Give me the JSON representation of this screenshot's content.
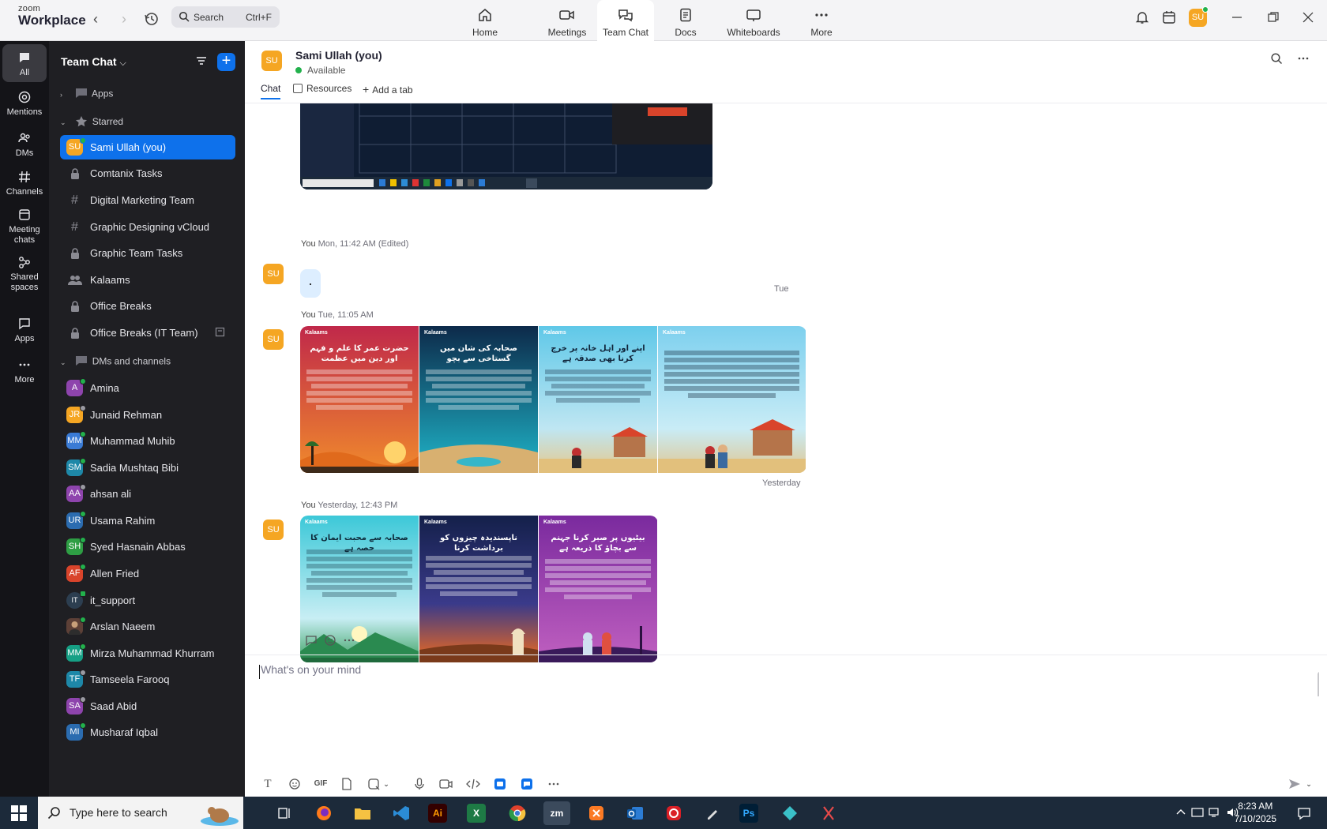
{
  "app": {
    "logo_line1": "zoom",
    "logo_line2": "Workplace"
  },
  "search": {
    "placeholder": "Search",
    "shortcut": "Ctrl+F"
  },
  "tabs": [
    {
      "label": "Home",
      "icon": "home-icon"
    },
    {
      "label": "Meetings",
      "icon": "video-icon"
    },
    {
      "label": "Team Chat",
      "icon": "chat-icon",
      "active": true
    },
    {
      "label": "Docs",
      "icon": "doc-icon"
    },
    {
      "label": "Whiteboards",
      "icon": "whiteboard-icon"
    },
    {
      "label": "More",
      "icon": "more-icon"
    }
  ],
  "user": {
    "initials": "SU",
    "status_color": "#22b14c"
  },
  "rail": [
    {
      "label": "All",
      "active": true
    },
    {
      "label": "Mentions"
    },
    {
      "label": "DMs"
    },
    {
      "label": "Channels"
    },
    {
      "label": "Meeting chats"
    },
    {
      "label": "Shared spaces"
    },
    {
      "label": "Apps"
    },
    {
      "label": "More"
    }
  ],
  "sidebar": {
    "title": "Team Chat",
    "sections": {
      "apps": "Apps",
      "starred": "Starred",
      "dms": "DMs and channels"
    },
    "starred": [
      {
        "label": "Sami Ullah (you)",
        "type": "avatar",
        "initials": "SU",
        "color": "#f5a623",
        "selected": true
      },
      {
        "label": "Comtanix Tasks",
        "type": "lock"
      },
      {
        "label": "Digital Marketing Team",
        "type": "hash"
      },
      {
        "label": "Graphic Designing vCloud",
        "type": "hash"
      },
      {
        "label": "Graphic Team Tasks",
        "type": "lock"
      },
      {
        "label": "Kalaams",
        "type": "group"
      },
      {
        "label": "Office Breaks",
        "type": "lock"
      },
      {
        "label": "Office Breaks (IT Team)",
        "type": "lock"
      }
    ],
    "dms": [
      {
        "label": "Amina",
        "initials": "A",
        "color": "#8e44ad",
        "status": "#22b14c"
      },
      {
        "label": "Junaid Rehman",
        "initials": "JR",
        "color": "#f5a623",
        "status": "#9a9aa2"
      },
      {
        "label": "Muhammad Muhib",
        "initials": "MM",
        "color": "#3a7bd5",
        "status": "#22b14c"
      },
      {
        "label": "Sadia Mushtaq Bibi",
        "initials": "SM",
        "color": "#1e88a8",
        "status": "#22b14c"
      },
      {
        "label": "ahsan ali",
        "initials": "AA",
        "color": "#8e44ad",
        "status": "#9a9aa2"
      },
      {
        "label": "Usama Rahim",
        "initials": "UR",
        "color": "#2b6cb0",
        "status": "#22b14c"
      },
      {
        "label": "Syed Hasnain Abbas",
        "initials": "SH",
        "color": "#2e9e44",
        "status": "#22b14c"
      },
      {
        "label": "Allen Fried",
        "initials": "AF",
        "color": "#d9442b",
        "status": "#22b14c"
      },
      {
        "label": "it_support",
        "initials": "IT",
        "color": "#2c3e50",
        "status": "#22b14c"
      },
      {
        "label": "Arslan Naeem",
        "initials": "",
        "color": "#5d4037",
        "status": "#22b14c"
      },
      {
        "label": "Mirza Muhammad Khurram",
        "initials": "MM",
        "color": "#16a085",
        "status": "#22b14c"
      },
      {
        "label": "Tamseela Farooq",
        "initials": "TF",
        "color": "#1e88a8",
        "status": "#9a9aa2"
      },
      {
        "label": "Saad Abid",
        "initials": "SA",
        "color": "#8e44ad",
        "status": "#9a9aa2"
      },
      {
        "label": "Musharaf Iqbal",
        "initials": "MI",
        "color": "#2b6cb0",
        "status": "#22b14c"
      }
    ]
  },
  "chat": {
    "name": "Sami Ullah (you)",
    "status": "Available",
    "tabs": {
      "chat": "Chat",
      "resources": "Resources",
      "add": "Add a tab"
    },
    "messages": [
      {
        "sender": "You",
        "time": "Mon, 11:42 AM (Edited)",
        "text": "."
      },
      {
        "sender": "You",
        "time": "Tue, 11:05 AM"
      },
      {
        "sender": "You",
        "time": "Yesterday, 12:43 PM"
      }
    ],
    "days": {
      "tue": "Tue",
      "yesterday": "Yesterday"
    },
    "cards_row1": [
      {
        "title": "حضرت عمر کا علم و فہم اور دین میں عظمت",
        "top": "#c0284a",
        "bottom": "#f08a2c"
      },
      {
        "title": "صحابہ کی شان میں گستاخی سے بچو",
        "top": "#0d2a4a",
        "bottom": "#1fb5c9"
      },
      {
        "title": "اپنے اور اہل خانہ پر خرچ کرنا بھی صدقہ ہے",
        "top": "#5fc8e8",
        "bottom": "#e6c88a"
      },
      {
        "title": "",
        "top": "#7dd0ee",
        "bottom": "#e0c690"
      }
    ],
    "cards_row2": [
      {
        "title": "صحابہ سے محبت ایمان کا حصہ ہے",
        "top": "#3cc8d8",
        "bottom": "#3aa060"
      },
      {
        "title": "ناپسندیدہ چیزوں کو برداشت کرنا",
        "top": "#14204a",
        "bottom": "#f06a1c"
      },
      {
        "title": "بیٹیوں پر صبر کرنا جہنم سے بچاؤ کا ذریعہ ہے",
        "top": "#7a2a9e",
        "bottom": "#c060c0"
      }
    ],
    "brand": "Kalaams",
    "composer_placeholder": "What's on your mind",
    "toolbar": {
      "gif": "GIF"
    }
  },
  "taskbar": {
    "search_placeholder": "Type here to search",
    "time": "8:23 AM",
    "date": "7/10/2025"
  }
}
